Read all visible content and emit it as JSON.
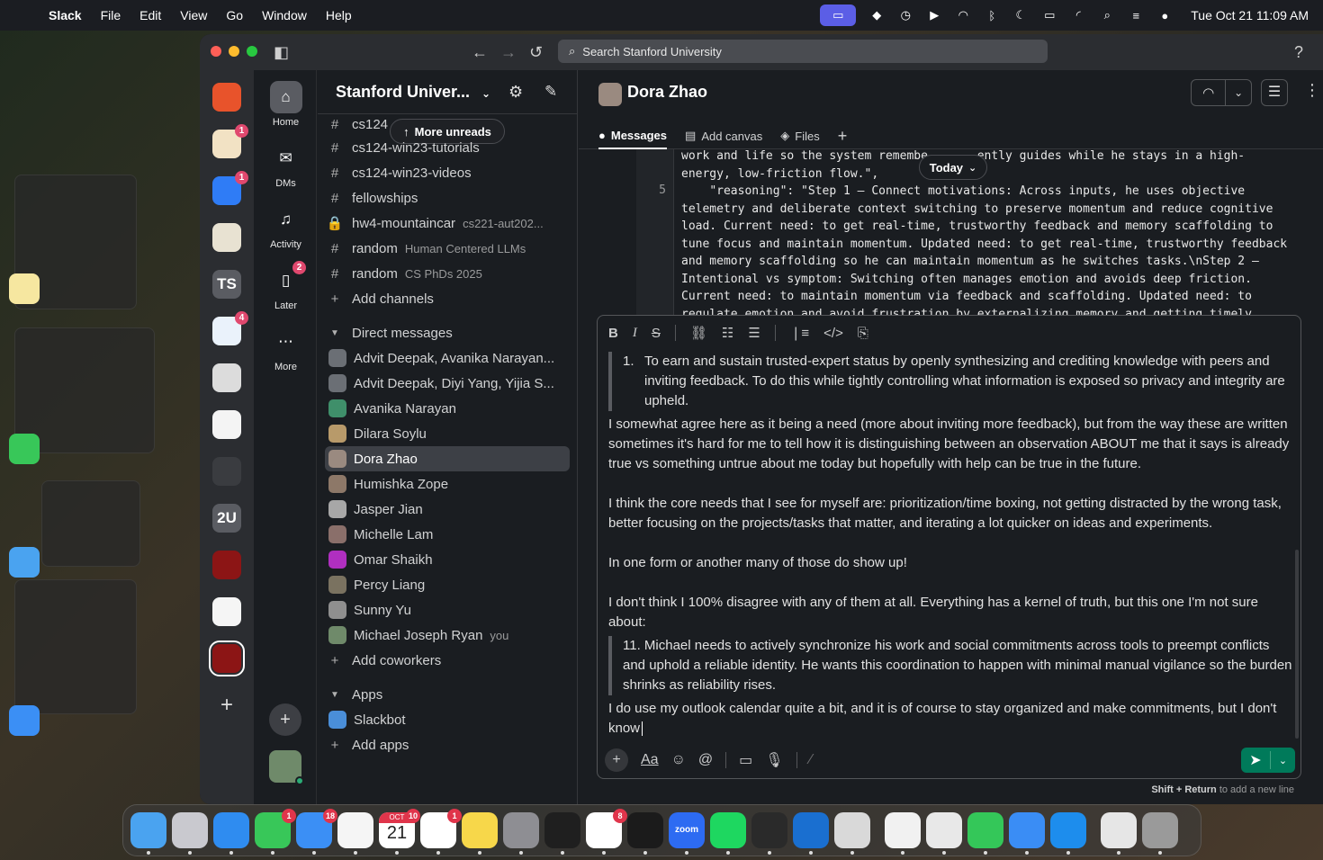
{
  "menubar": {
    "app": "Slack",
    "items": [
      "File",
      "Edit",
      "View",
      "Go",
      "Window",
      "Help"
    ],
    "clock": "Tue Oct 21  11:09 AM"
  },
  "titlebar": {
    "search_placeholder": "Search Stanford University"
  },
  "rail": {
    "home": "Home",
    "dms": "DMs",
    "activity": "Activity",
    "later": "Later",
    "later_badge": "2",
    "more": "More"
  },
  "workspaces": [
    {
      "label": "",
      "color": "#e8532b",
      "badge": ""
    },
    {
      "label": "",
      "color": "#f2e2c4",
      "badge": "1"
    },
    {
      "label": "",
      "color": "#2f7cf6",
      "badge": "1"
    },
    {
      "label": "",
      "color": "#e8e2d2",
      "badge": ""
    },
    {
      "label": "TS",
      "color": "#5a5c62",
      "badge": ""
    },
    {
      "label": "",
      "color": "#eaf2fb",
      "badge": "4"
    },
    {
      "label": "",
      "color": "#dcdcdc",
      "badge": ""
    },
    {
      "label": "",
      "color": "#f4f4f4",
      "badge": ""
    },
    {
      "label": "",
      "color": "#3a3c40",
      "badge": ""
    },
    {
      "label": "2U",
      "color": "#5a5c62",
      "badge": ""
    },
    {
      "label": "",
      "color": "#8c1515",
      "badge": ""
    },
    {
      "label": "",
      "color": "#f5f5f5",
      "badge": ""
    },
    {
      "label": "",
      "color": "#8c1515",
      "badge": ""
    }
  ],
  "sidebar": {
    "workspace_name": "Stanford Univer...",
    "more_unreads": "More unreads",
    "channels": [
      {
        "prefix": "#",
        "name": "cs124-win23-tutorials",
        "sub": ""
      },
      {
        "prefix": "#",
        "name": "cs124-win23-videos",
        "sub": ""
      },
      {
        "prefix": "#",
        "name": "fellowships",
        "sub": ""
      },
      {
        "prefix": "🔒",
        "name": "hw4-mountaincar",
        "sub": "cs221-aut202..."
      },
      {
        "prefix": "#",
        "name": "random",
        "sub": "Human Centered LLMs"
      },
      {
        "prefix": "#",
        "name": "random",
        "sub": "CS PhDs 2025"
      }
    ],
    "add_channels": "Add channels",
    "dm_section": "Direct messages",
    "dms": [
      {
        "name": "Advit Deepak, Avanika Narayan...",
        "sub": "",
        "color": "#6b6f75"
      },
      {
        "name": "Advit Deepak, Diyi Yang, Yijia S...",
        "sub": "",
        "color": "#6b6f75"
      },
      {
        "name": "Avanika Narayan",
        "sub": "",
        "color": "#3f8f6a"
      },
      {
        "name": "Dilara Soylu",
        "sub": "",
        "color": "#b89a6a"
      },
      {
        "name": "Dora Zhao",
        "sub": "",
        "color": "#9a8a80"
      },
      {
        "name": "Humishka Zope",
        "sub": "",
        "color": "#8d7868"
      },
      {
        "name": "Jasper Jian",
        "sub": "",
        "color": "#a7a7a7"
      },
      {
        "name": "Michelle Lam",
        "sub": "",
        "color": "#8a6f6a"
      },
      {
        "name": "Omar Shaikh",
        "sub": "",
        "color": "#b02fc0"
      },
      {
        "name": "Percy Liang",
        "sub": "",
        "color": "#7a7260"
      },
      {
        "name": "Sunny Yu",
        "sub": "",
        "color": "#8f8f8f"
      },
      {
        "name": "Michael Joseph Ryan",
        "sub": "you",
        "color": "#6f8a6a"
      }
    ],
    "add_coworkers": "Add coworkers",
    "apps_section": "Apps",
    "apps": [
      {
        "name": "Slackbot"
      }
    ],
    "add_apps": "Add apps"
  },
  "channel": {
    "name": "Dora Zhao",
    "tabs": [
      "Messages",
      "Add canvas",
      "Files"
    ],
    "today": "Today"
  },
  "code": {
    "line_number": "5",
    "text": "work and life so the system remembe    ...ently guides while he stays in a high-\nenergy, low-friction flow.\",\n    \"reasoning\": \"Step 1 – Connect motivations: Across inputs, he uses objective\ntelemetry and deliberate context switching to preserve momentum and reduce cognitive\nload. Current need: to get real-time, trustworthy feedback and memory scaffolding to\ntune focus and maintain momentum. Updated need: to get real-time, trustworthy feedback\nand memory scaffolding so he can maintain momentum as he switches tasks.\\nStep 2 –\nIntentional vs symptom: Switching often manages emotion and avoids deep friction.\nCurrent need: to maintain momentum via feedback and scaffolding. Updated need: to\nregulate emotion and avoid frustration by externalizing memory and getting timely"
  },
  "composer": {
    "quote1_num": "1.",
    "quote1": "To earn and sustain trusted-expert status by openly synthesizing and crediting knowledge with peers and inviting feedback. To do this while tightly controlling what information is exposed so privacy and integrity are upheld.",
    "p1": "I somewhat agree here as it being a need (more about inviting more feedback), but from the way these are written sometimes it's hard for me to tell how it is distinguishing between an observation ABOUT me that it says is already true vs something untrue about me today but hopefully with help can be true in the future.",
    "p2": "I think the core needs that I see for myself are: prioritization/time boxing, not getting distracted by the wrong task, better focusing on the projects/tasks that matter, and iterating a lot quicker on ideas and experiments.",
    "p3": "In one form or another many of those do show up!",
    "p4": "I don't think I 100% disagree with any of them at all.  Everything has a kernel of truth, but this one I'm not sure about:",
    "quote2": "11. Michael needs to actively synchronize his work and social commitments across tools to preempt conflicts and uphold a reliable identity. He wants this coordination to happen with minimal manual vigilance so the burden shrinks as reliability rises.",
    "p5": "I do use my outlook calendar quite a bit, and it is of course to stay organized and make commitments, but I don't know",
    "aa": "Aa"
  },
  "hint": {
    "keys": "Shift + Return",
    "text": " to add a new line"
  },
  "dock": [
    {
      "name": "finder",
      "color": "#4aa3f0",
      "badge": ""
    },
    {
      "name": "launchpad",
      "color": "#c9c9cf",
      "badge": ""
    },
    {
      "name": "safari",
      "color": "#2f8cf0",
      "badge": ""
    },
    {
      "name": "messages",
      "color": "#38c759",
      "badge": "1"
    },
    {
      "name": "mail",
      "color": "#3b8ff5",
      "badge": "18"
    },
    {
      "name": "photos",
      "color": "#f5f5f5",
      "badge": ""
    },
    {
      "name": "calendar",
      "color": "#ffffff",
      "badge": "10"
    },
    {
      "name": "reminders",
      "color": "#ffffff",
      "badge": "1"
    },
    {
      "name": "notes",
      "color": "#f7d74a",
      "badge": ""
    },
    {
      "name": "settings",
      "color": "#8e8e93",
      "badge": ""
    },
    {
      "name": "chatgpt",
      "color": "#1f1f1f",
      "badge": ""
    },
    {
      "name": "slack",
      "color": "#ffffff",
      "badge": "8"
    },
    {
      "name": "terminal",
      "color": "#1b1b1b",
      "badge": ""
    },
    {
      "name": "zoom",
      "color": "#2d6bf2",
      "badge": ""
    },
    {
      "name": "spotify",
      "color": "#1ed760",
      "badge": ""
    },
    {
      "name": "cube",
      "color": "#2a2a2a",
      "badge": ""
    },
    {
      "name": "outlook",
      "color": "#1a6fd0",
      "badge": ""
    },
    {
      "name": "preview",
      "color": "#d9d9d9",
      "badge": ""
    },
    {
      "name": "chrome",
      "color": "#f1f1f1",
      "badge": ""
    },
    {
      "name": "zotero",
      "color": "#e8e8e8",
      "badge": ""
    },
    {
      "name": "numbers",
      "color": "#34c759",
      "badge": ""
    },
    {
      "name": "keynote",
      "color": "#3a8df5",
      "badge": ""
    },
    {
      "name": "docker",
      "color": "#1d8ded",
      "badge": ""
    },
    {
      "name": "document",
      "color": "#e6e6e6",
      "badge": ""
    },
    {
      "name": "trash",
      "color": "#9a9a9a",
      "badge": ""
    }
  ],
  "dock_labels": {
    "calendar_month": "OCT",
    "calendar_day": "21",
    "zoom": "zoom"
  }
}
